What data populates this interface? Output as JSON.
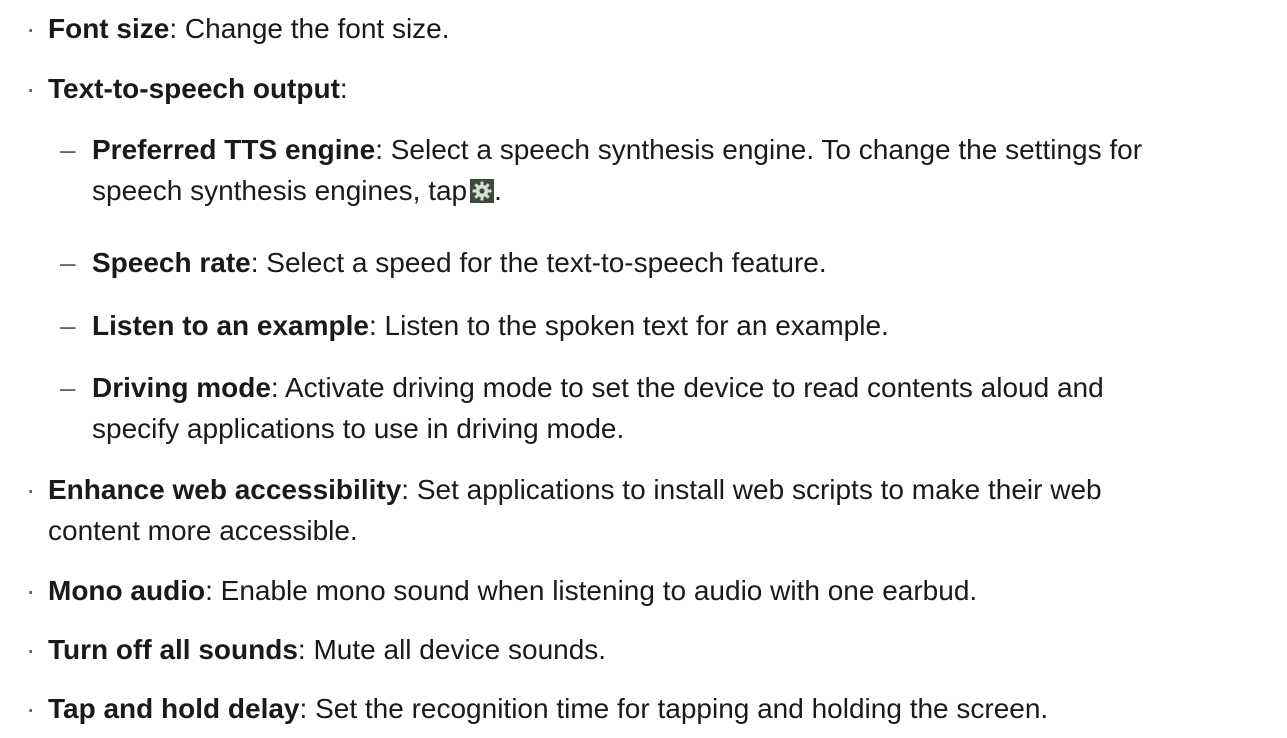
{
  "bullet_glyph": "·",
  "dash_glyph": "–",
  "items": [
    {
      "term": "Font size",
      "desc": ": Change the font size."
    },
    {
      "term": "Text-to-speech output",
      "desc": ":"
    },
    {
      "term": "Preferred TTS engine",
      "desc_line1": ": Select a speech synthesis engine. To change the settings for",
      "desc_line2": "speech synthesis engines, tap",
      "desc_end": ".",
      "icon": "gear-icon"
    },
    {
      "term": "Speech rate",
      "desc": ": Select a speed for the text-to-speech feature."
    },
    {
      "term": "Listen to an example",
      "desc": ": Listen to the spoken text for an example."
    },
    {
      "term": "Driving mode",
      "desc_line1": ": Activate driving mode to set the device to read contents aloud and",
      "desc_line2": "specify applications to use in driving mode."
    },
    {
      "term": "Enhance web accessibility",
      "desc_line1": ": Set applications to install web scripts to make their web",
      "desc_line2": "content more accessible."
    },
    {
      "term": "Mono audio",
      "desc": ": Enable mono sound when listening to audio with one earbud."
    },
    {
      "term": "Turn off all sounds",
      "desc": ": Mute all device sounds."
    },
    {
      "term": "Tap and hold delay",
      "desc": ": Set the recognition time for tapping and holding the screen."
    }
  ]
}
